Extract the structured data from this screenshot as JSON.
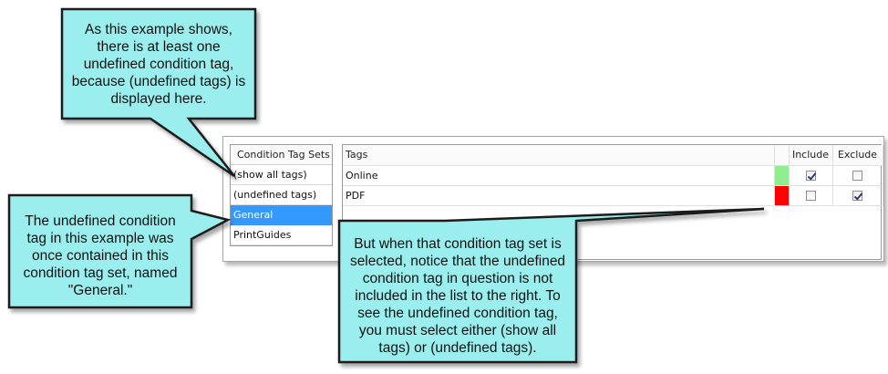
{
  "sets": {
    "header": "Condition Tag Sets",
    "items": [
      "(show all tags)",
      "(undefined tags)",
      "General",
      "PrintGuides"
    ],
    "selected": "General"
  },
  "tags": {
    "columns": {
      "name": "Tags",
      "color": "",
      "include": "Include",
      "exclude": "Exclude"
    },
    "rows": [
      {
        "name": "Online",
        "color": "#90ee90",
        "include": true,
        "exclude": false
      },
      {
        "name": "PDF",
        "color": "#ff0000",
        "include": false,
        "exclude": true
      }
    ]
  },
  "callouts": {
    "top": "As this example shows, there is at least one undefined condition tag, because (undefined tags) is displayed here.",
    "left": "The undefined condition tag in this example was once contained in this condition tag set, named \"General.\"",
    "bottom": "But when that condition tag set is selected, notice that the undefined condition tag in question is not included in the list to the right. To see the undefined condition tag, you must select either (show all tags) or (undefined tags)."
  },
  "colors": {
    "callout_fill": "#9aeeee",
    "callout_border": "#1a1a1a",
    "selection": "#3399ff"
  }
}
